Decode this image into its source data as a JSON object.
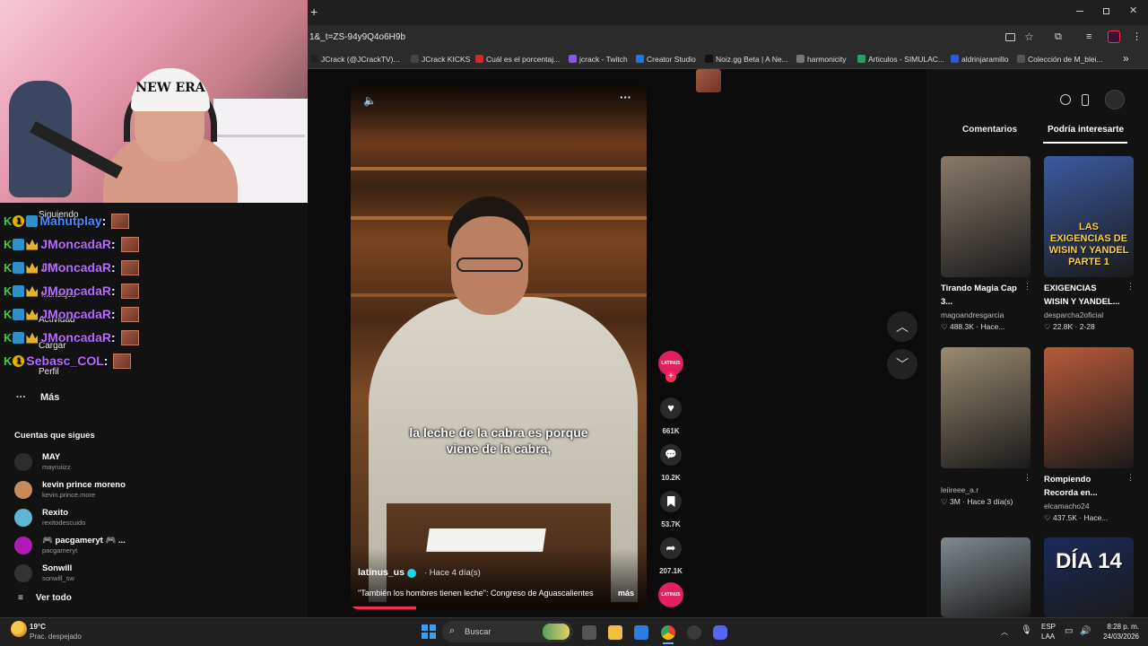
{
  "browser": {
    "new_tab": "+",
    "url": "1&_t=ZS-94y9Q4o6H9b",
    "bookmarks": [
      {
        "label": "JCrack (@JCrackTV)...",
        "color": "#222"
      },
      {
        "label": "JCrack KICKS",
        "color": "#444"
      },
      {
        "label": "Cuál es el porcentaj...",
        "color": "#d12a2a"
      },
      {
        "label": "jcrack - Twitch",
        "color": "#8c55e8"
      },
      {
        "label": "Creator Studio",
        "color": "#1877f2"
      },
      {
        "label": "Noiz.gg Beta | A Ne...",
        "color": "#111"
      },
      {
        "label": "harmonicity",
        "color": "#777"
      },
      {
        "label": "Articulos - SIMULAC...",
        "color": "#1fa463"
      },
      {
        "label": "aldrinjaramillo",
        "color": "#2b5bd9"
      },
      {
        "label": "Colección de M_blei...",
        "color": "#555"
      }
    ],
    "more_bookmarks": "»"
  },
  "webcam": {
    "cap_text": "NEW ERA"
  },
  "sidebar": {
    "nav": [
      "Siguiendo",
      "LIVE",
      "Mensajes",
      "Actividad",
      "Cargar",
      "Perfil"
    ],
    "more": "Más",
    "following_title": "Cuentas que sigues",
    "accounts": [
      {
        "name": "MAY",
        "handle": "mayruiizz",
        "color": "#2d2d2d"
      },
      {
        "name": "kevin prince moreno",
        "handle": "kevin.prince.more",
        "color": "#c98a5a"
      },
      {
        "name": "Rexito",
        "handle": "rexitodescuido",
        "color": "#5fb6d6"
      },
      {
        "name": "🎮 pacgameryt 🎮 ...",
        "handle": "pacgameryt",
        "color": "#b21ab5"
      },
      {
        "name": "Sonwill",
        "handle": "sonwill_sw",
        "color": "#333"
      }
    ],
    "see_all": "Ver todo"
  },
  "chat": [
    {
      "user": "Mahutplay",
      "color": "#4a8cff",
      "badges": [
        "k",
        "1",
        "sq"
      ]
    },
    {
      "user": "JMoncadaR",
      "color": "#b86bff",
      "badges": [
        "k",
        "sq",
        "cr"
      ]
    },
    {
      "user": "JMoncadaR",
      "color": "#b86bff",
      "badges": [
        "k",
        "sq",
        "cr"
      ]
    },
    {
      "user": "JMoncadaR",
      "color": "#b86bff",
      "badges": [
        "k",
        "sq",
        "cr"
      ]
    },
    {
      "user": "JMoncadaR",
      "color": "#b86bff",
      "badges": [
        "k",
        "sq",
        "cr"
      ]
    },
    {
      "user": "JMoncadaR",
      "color": "#b86bff",
      "badges": [
        "k",
        "sq",
        "cr"
      ]
    },
    {
      "user": "Sebasc_COL",
      "color": "#b86bff",
      "badges": [
        "k",
        "1"
      ]
    }
  ],
  "video": {
    "caption_line1": "la leche de la cabra es porque",
    "caption_line2": "viene de la cabra,",
    "username": "latinus_us",
    "time": "· Hace 4 día(s)",
    "description": "\"También los hombres tienen leche\": Congreso de Aguascalientes",
    "more": "más",
    "progress": 0.22
  },
  "actions": {
    "avatar_label": "LATINUS",
    "likes": "661K",
    "comments": "10.2K",
    "saves": "53.7K",
    "shares": "207.1K"
  },
  "right_panel": {
    "tab_comments": "Comentarios",
    "tab_suggested": "Podría interesarte",
    "items": [
      {
        "title1": "Tirando Magia Cap",
        "title2": "3...",
        "user": "magoandresgarcia",
        "stats": "♡ 488.3K · Hace...",
        "thumb_text": "",
        "bg": "#8a7a6a"
      },
      {
        "title1": "EXIGENCIAS",
        "title2": "WISIN Y YANDEL...",
        "user": "desparcha2oficial",
        "stats": "♡ 22.8K · 2-28",
        "thumb_text": "LAS EXIGENCIAS DE WISIN Y YANDEL PARTE 1",
        "bg": "#3b5aa0"
      },
      {
        "title1": "",
        "title2": "",
        "user": "leiireee_a.r",
        "stats": "♡ 3M · Hace 3 día(s)",
        "thumb_text": "",
        "bg": "#9a8a70"
      },
      {
        "title1": "Rompiendo",
        "title2": "Recorda en...",
        "user": "elcamacho24",
        "stats": "♡ 437.5K · Hace...",
        "thumb_text": "",
        "bg": "#b85a3a"
      },
      {
        "title1": "",
        "title2": "",
        "user": "",
        "stats": "",
        "thumb_text": "",
        "bg": "#7f8a90"
      },
      {
        "title1": "",
        "title2": "",
        "user": "",
        "stats": "",
        "thumb_text": "DÍA 14",
        "bg": "#1a2a5a"
      }
    ]
  },
  "taskbar": {
    "weather_temp": "19°C",
    "weather_desc": "Prac. despejado",
    "search_placeholder": "Buscar",
    "lang1": "ESP",
    "lang2": "LAA",
    "time": "8:28 p. m.",
    "date": "24/03/2026"
  }
}
